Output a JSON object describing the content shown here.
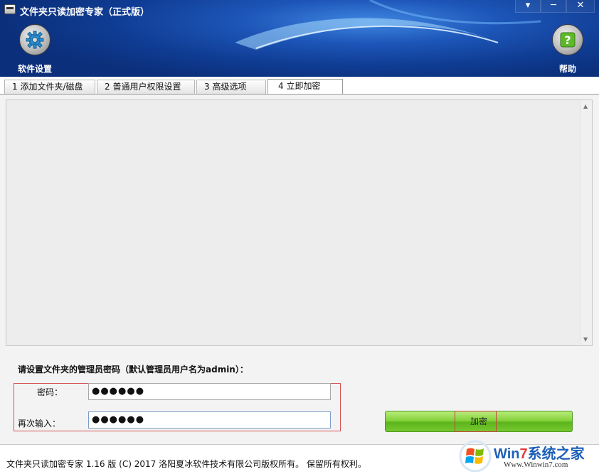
{
  "window": {
    "title": "文件夹只读加密专家（正式版）",
    "controls": {
      "minimize": "▾",
      "restore": "─",
      "close": "✕"
    }
  },
  "toolbar": {
    "settings_label": "软件设置",
    "help_label": "帮助",
    "settings_icon": "gear-icon",
    "help_icon": "question-icon"
  },
  "tabs": [
    {
      "label": "1 添加文件夹/磁盘",
      "active": false
    },
    {
      "label": "2 普通用户权限设置",
      "active": false
    },
    {
      "label": "3 高级选项",
      "active": false
    },
    {
      "label": "4 立即加密",
      "active": true
    }
  ],
  "form": {
    "prompt": "请设置文件夹的管理员密码（默认管理员用户名为admin）：",
    "password_label": "密码：",
    "password_value": "●●●●●●",
    "confirm_label": "再次输入：",
    "confirm_value": "●●●●●●",
    "encrypt_button": "加密"
  },
  "status": {
    "text": "文件夹只读加密专家 1.16 版 (C) 2017 洛阳夏冰软件技术有限公司版权所有。 保留所有权利。"
  },
  "watermark": {
    "brand_prefix": "Win",
    "brand_seven": "7",
    "brand_suffix": "系统之家",
    "url": "Www.Winwin7.com"
  },
  "colors": {
    "header_blue": "#1d56b8",
    "button_green": "#77c730",
    "highlight_red": "#d65050"
  }
}
